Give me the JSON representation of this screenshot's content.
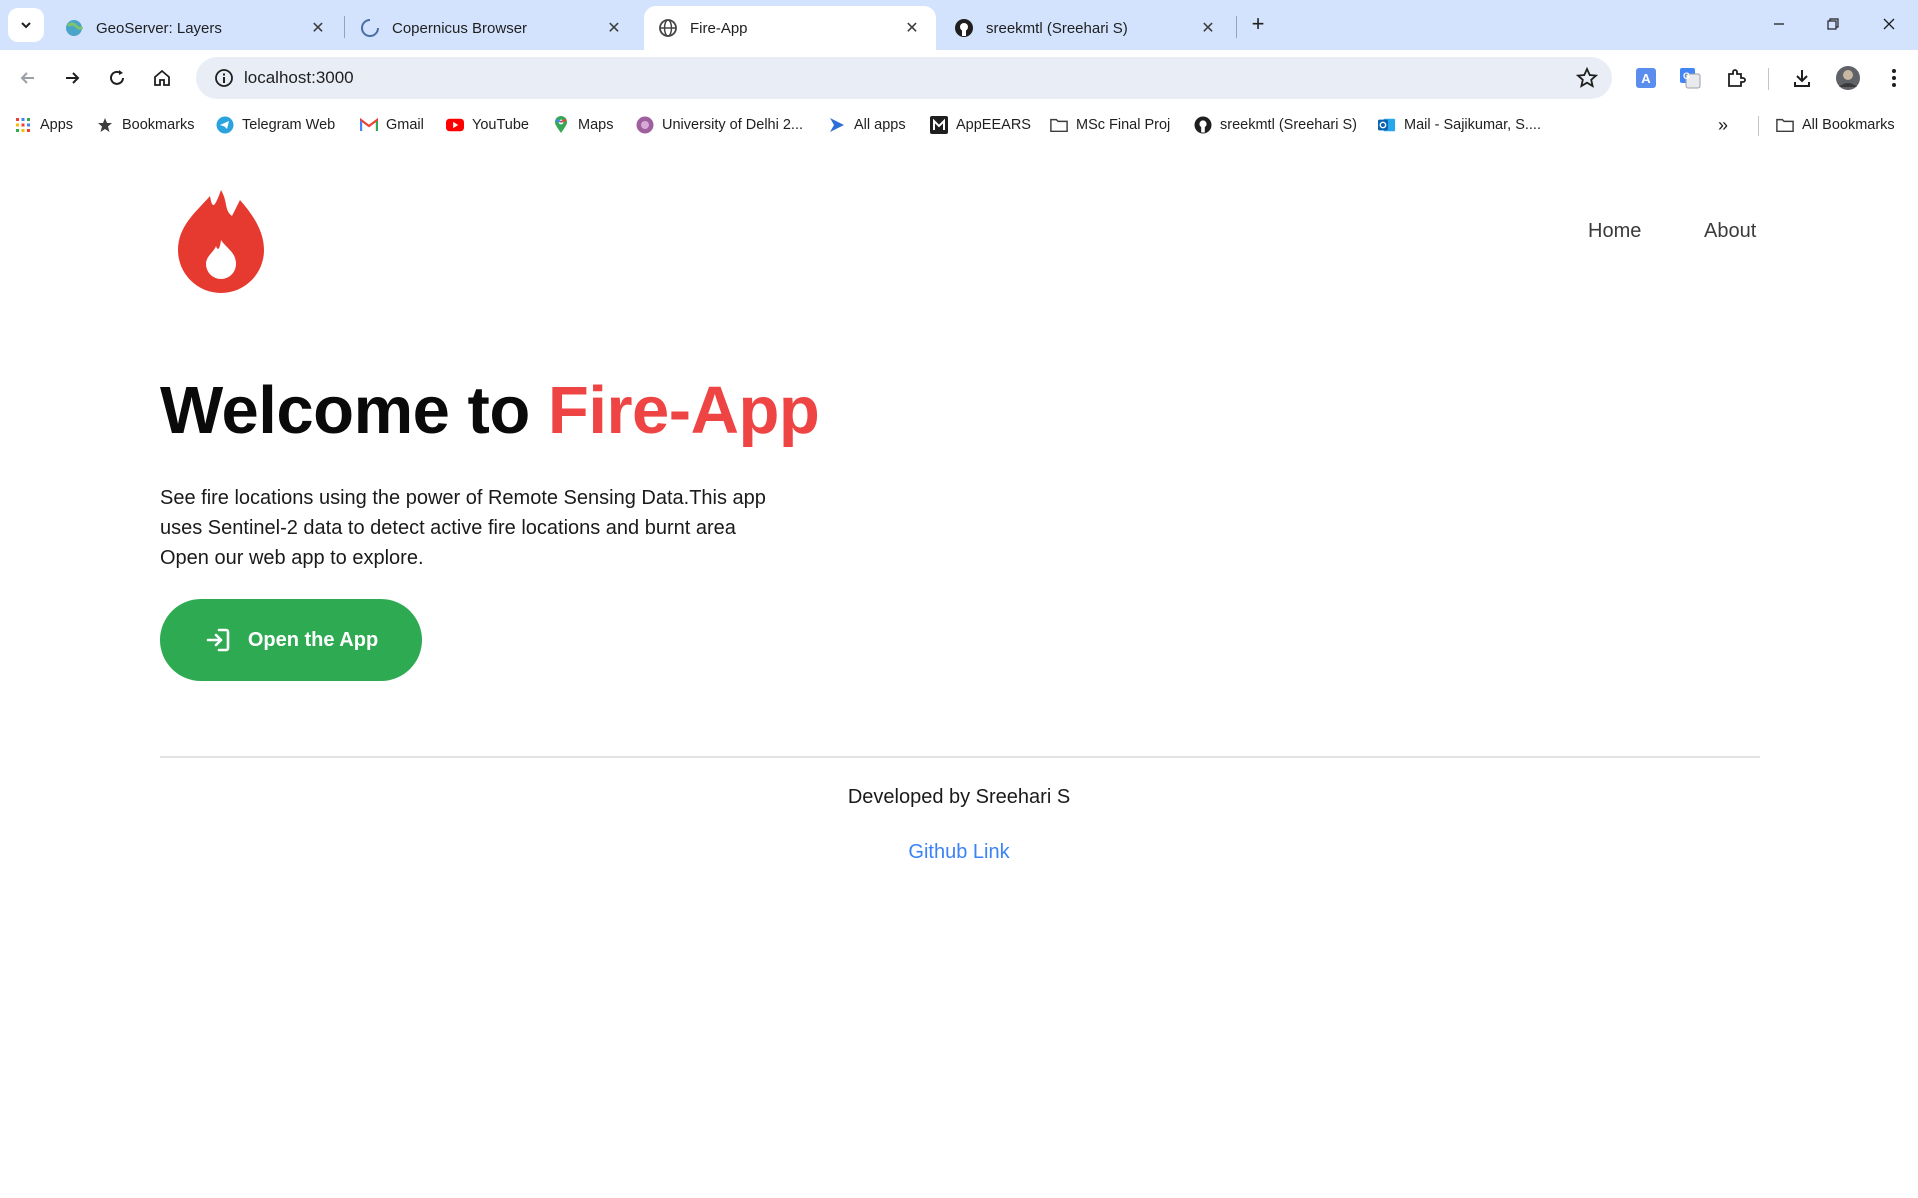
{
  "browser": {
    "tabs": [
      {
        "title": "GeoServer: Layers",
        "icon": "geoserver-icon",
        "active": false
      },
      {
        "title": "Copernicus Browser",
        "icon": "loading-spinner-icon",
        "active": false
      },
      {
        "title": "Fire-App",
        "icon": "globe-icon",
        "active": true
      },
      {
        "title": "sreekmtl (Sreehari S)",
        "icon": "github-icon",
        "active": false
      }
    ],
    "close_glyph": "✕",
    "new_tab_glyph": "+",
    "url": "localhost:3000",
    "bookmarks": [
      {
        "label": "Apps",
        "icon": "apps-grid-icon"
      },
      {
        "label": "Bookmarks",
        "icon": "star-icon"
      },
      {
        "label": "Telegram Web",
        "icon": "telegram-icon"
      },
      {
        "label": "Gmail",
        "icon": "gmail-icon"
      },
      {
        "label": "YouTube",
        "icon": "youtube-icon"
      },
      {
        "label": "Maps",
        "icon": "maps-pin-icon"
      },
      {
        "label": "University of Delhi 2...",
        "icon": "university-icon"
      },
      {
        "label": "All apps",
        "icon": "all-apps-icon"
      },
      {
        "label": "AppEEARS",
        "icon": "appeears-icon"
      },
      {
        "label": "MSc Final Proj",
        "icon": "folder-icon"
      },
      {
        "label": "sreekmtl (Sreehari S)",
        "icon": "github-icon"
      },
      {
        "label": "Mail - Sajikumar, S....",
        "icon": "outlook-icon"
      }
    ],
    "overflow_glyph": "»",
    "all_bookmarks": "All Bookmarks"
  },
  "page": {
    "nav": {
      "home": "Home",
      "about": "About"
    },
    "hero": {
      "title_prefix": "Welcome to ",
      "title_accent": "Fire-App",
      "line1": "See fire locations using the power of Remote Sensing Data.This app",
      "line2": "uses Sentinel-2 data to detect active fire locations and burnt area",
      "line3": "Open our web app to explore."
    },
    "cta_label": "Open the App",
    "footer": {
      "credit": "Developed by Sreehari S",
      "link": "Github Link"
    }
  },
  "colors": {
    "accent_red": "#ef4444",
    "cta_green": "#2daa52",
    "link_blue": "#3b82f6",
    "tabstrip": "#d3e3fd"
  }
}
